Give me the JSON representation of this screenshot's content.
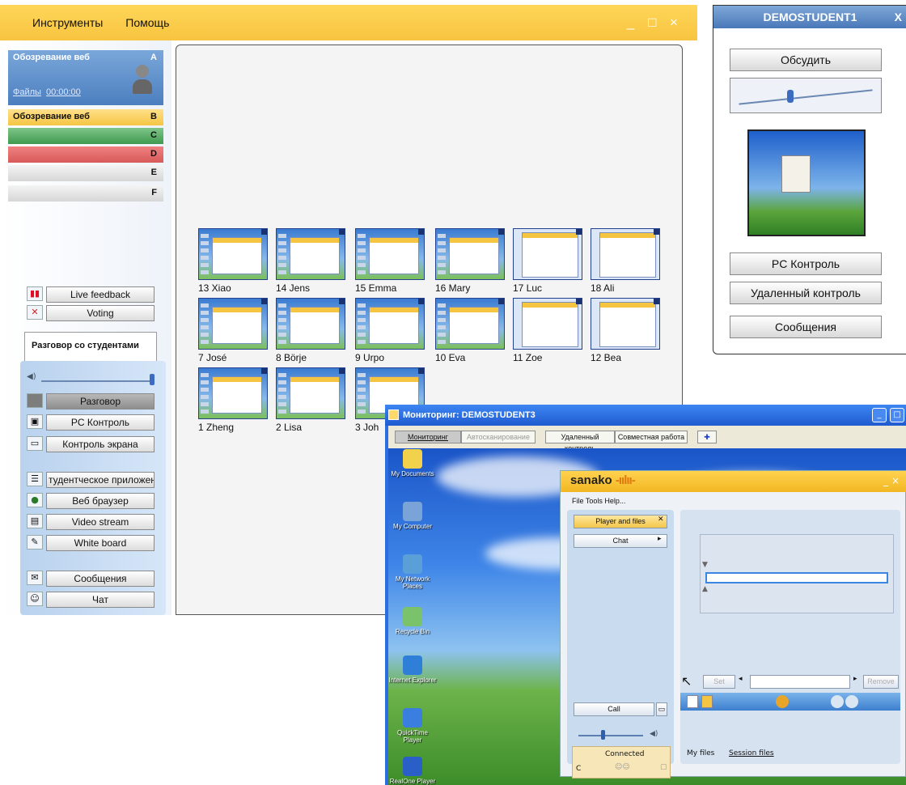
{
  "menu": {
    "items": [
      "Инструменты",
      "Помощь"
    ],
    "window_buttons": "_ □ ×"
  },
  "groups": {
    "a": {
      "label": "Обозревание веб",
      "letter": "A",
      "file_link": "Файлы",
      "time": "00:00:00"
    },
    "b": {
      "label": "Обозревание веб",
      "letter": "B"
    },
    "c": {
      "letter": "C"
    },
    "d": {
      "letter": "D"
    },
    "e": {
      "letter": "E"
    },
    "f": {
      "letter": "F"
    }
  },
  "feedback": {
    "live": "Live feedback",
    "voting": "Voting"
  },
  "talk": {
    "tab_label": "Разговор со студентами",
    "buttons": [
      "Разговор",
      "PC Контроль",
      "Контроль экрана",
      "тудентческое приложени",
      "Веб браузер",
      "Video stream",
      "White board",
      "Сообщения",
      "Чат"
    ]
  },
  "students": [
    "13 Xiao",
    "14 Jens",
    "15 Emma",
    "16 Mary",
    "17 Luc",
    "18 Ali",
    "7 José",
    "8 Börje",
    "9 Urpo",
    "10 Eva",
    "11 Zoe",
    "12 Bea",
    "1 Zheng",
    "2 Lisa",
    "3 Joh"
  ],
  "student_panel": {
    "title": "DEMOSTUDENT1",
    "close": "X",
    "discuss": "Обсудить",
    "pc_control": "PC Контроль",
    "remote_control": "Удаленный контроль",
    "messages": "Сообщения"
  },
  "monitoring": {
    "title": "Мониторинг:  DEMOSTUDENT3",
    "tabs": [
      "Мониторинг",
      "Автосканирование",
      "Удаленный контроль",
      "Совместная работа"
    ],
    "desktop_icons": [
      "My Documents",
      "My Computer",
      "My Network Places",
      "Recycle Bin",
      "Internet Explorer",
      "QuickTime Player",
      "RealOne Player"
    ]
  },
  "sanako": {
    "logo": "sanako",
    "menu": "File  Tools  Help...",
    "player_and_files": "Player and files",
    "chat": "Chat",
    "call": "Call",
    "connected": "Connected",
    "c_label": "C",
    "set": "Set",
    "remove": "Remove",
    "my_files": "My files",
    "session_files": "Session files"
  }
}
